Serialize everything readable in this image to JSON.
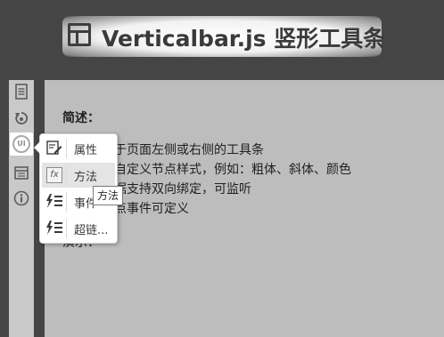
{
  "header": {
    "title": "Verticalbar.js 竖形工具条"
  },
  "sidebar": {
    "items": [
      {
        "icon": "document-icon",
        "glyph": "📄"
      },
      {
        "icon": "refresh-hand-icon",
        "glyph": "⟲"
      },
      {
        "icon": "ui-icon",
        "glyph": "UI"
      },
      {
        "icon": "calendar-icon",
        "glyph": "▦"
      },
      {
        "icon": "info-icon",
        "glyph": "ⓘ"
      }
    ]
  },
  "content": {
    "heading": "简述：",
    "lines": [
      "于页面左侧或右侧的工具条",
      "自定义节点样式，例如：粗体、斜体、颜色",
      "据支持双向绑定，可监听",
      "点事件可定义",
      "演示："
    ]
  },
  "popup": {
    "items": [
      {
        "label": "属性",
        "icon": "edit-icon",
        "glyph": "✎"
      },
      {
        "label": "方法",
        "icon": "function-icon",
        "glyph": "fx"
      },
      {
        "label": "事件",
        "icon": "lightning-list-icon",
        "glyph": "ϟ☰"
      },
      {
        "label": "超链...",
        "icon": "lightning-list-icon",
        "glyph": "ϟ☰"
      }
    ],
    "hovered_index": 1
  },
  "tooltip": {
    "text": "方法"
  }
}
